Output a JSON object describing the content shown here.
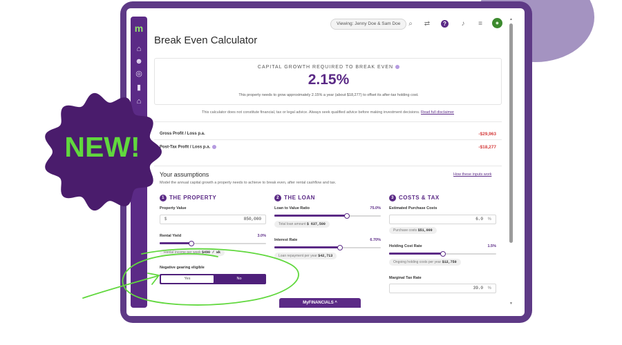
{
  "badge": {
    "text": "NEW!"
  },
  "topbar": {
    "viewing": "Viewing: Jenny Doe & Sam Doe"
  },
  "page": {
    "title": "Break Even Calculator"
  },
  "capital": {
    "label": "CAPITAL GROWTH REQUIRED TO BREAK EVEN",
    "value": "2.15%",
    "description": "This property needs to grow approximately 2.15% a year (about $18,277) to offset its after-tax holding cost."
  },
  "disclaimer": {
    "text": "This calculator does not constitute financial, tax or legal advice. Always seek qualified advice before making investment decisions.",
    "link": "Read full disclaimer"
  },
  "results": [
    {
      "label": "Gross Profit / Loss p.a.",
      "value": "-$29,963"
    },
    {
      "label": "Post-Tax Profit / Loss p.a.",
      "value": "-$18,277"
    }
  ],
  "assumptions": {
    "title": "Your assumptions",
    "subtitle": "Model the annual capital growth a property needs to achieve to break even, after rental cashflow and tax.",
    "link": "How these inputs work"
  },
  "property": {
    "num": "1",
    "title": "THE PROPERTY",
    "value_label": "Property Value",
    "value_prefix": "$",
    "value": "850,000",
    "yield_label": "Rental Yield",
    "yield_value": "3.0%",
    "yield_level": 0.3,
    "yield_chip_text": "Rental income per week",
    "yield_chip_value": "$490 / wk",
    "gearing_label": "Negative gearing eligible",
    "gearing_yes": "Yes",
    "gearing_no": "No"
  },
  "loan": {
    "num": "2",
    "title": "THE LOAN",
    "lvr_label": "Loan to Value Ratio",
    "lvr_value": "75.0%",
    "lvr_level": 0.68,
    "lvr_chip_text": "Total loan amount",
    "lvr_chip_value": "$ 637,500",
    "rate_label": "Interest Rate",
    "rate_value": "6.70%",
    "rate_level": 0.62,
    "rate_chip_text": "Loan repayment per year",
    "rate_chip_value": "$42,713"
  },
  "costs": {
    "num": "3",
    "title": "COSTS & TAX",
    "purchase_label": "Estimated Purchase Costs",
    "purchase_value": "6.0",
    "purchase_suffix": "%",
    "purchase_chip_text": "Purchase costs",
    "purchase_chip_value": "$51,000",
    "holding_label": "Holding Cost Rate",
    "holding_value": "1.5%",
    "holding_level": 0.5,
    "holding_chip_text": "Ongoing holding costs per year",
    "holding_chip_value": "$12,750",
    "tax_label": "Marginal Tax Rate",
    "tax_value": "39.0",
    "tax_suffix": "%"
  },
  "footer_tab": "MyFINANCIALS ^",
  "colors": {
    "brand": "#5b2a86",
    "accent": "#61d83e",
    "negative": "#d43c3c",
    "frame": "#5e3a86"
  }
}
